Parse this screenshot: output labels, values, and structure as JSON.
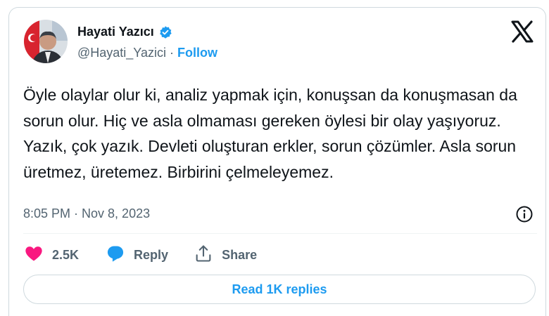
{
  "author": {
    "name": "Hayati Yazıcı",
    "handle": "@Hayati_Yazici",
    "separator": "·",
    "follow_label": "Follow",
    "verified": true
  },
  "tweet": {
    "text": "Öyle olaylar olur ki, analiz yapmak için, konuşsan da konuşmasan da sorun olur. Hiç ve asla olmaması gereken öylesi bir olay yaşıyoruz. Yazık, çok yazık. Devleti oluşturan erkler, sorun çözümler. Asla sorun üretmez, üretemez. Birbirini çelmeleyemez.",
    "timestamp": "8:05 PM · Nov 8, 2023"
  },
  "actions": {
    "like_count": "2.5K",
    "reply_label": "Reply",
    "share_label": "Share"
  },
  "footer": {
    "read_replies_label": "Read 1K replies"
  },
  "colors": {
    "accent": "#1d9bf0",
    "like": "#f91880",
    "muted": "#536471",
    "text": "#0f1419"
  },
  "icons": [
    "verified-badge-icon",
    "x-logo-icon",
    "info-icon",
    "heart-icon",
    "reply-bubble-icon",
    "share-icon"
  ]
}
